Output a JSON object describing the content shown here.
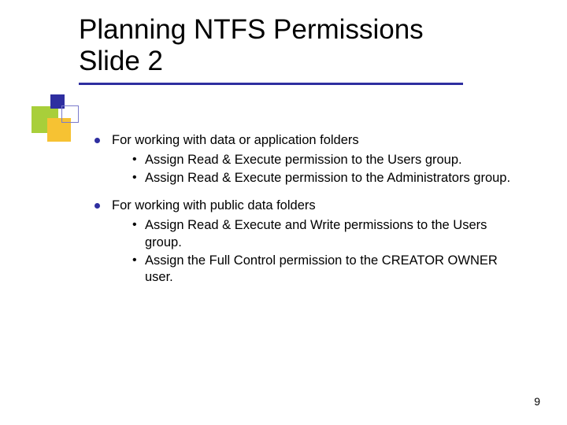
{
  "title": {
    "line1": "Planning NTFS Permissions",
    "line2": "Slide 2"
  },
  "bullets": [
    {
      "text": "For working with data or application folders",
      "sub": [
        "Assign Read & Execute permission to the Users group.",
        "Assign Read & Execute permission to the Administrators group."
      ]
    },
    {
      "text": "For working with public data folders",
      "sub": [
        "Assign Read & Execute and Write permissions to the Users group.",
        "Assign the Full Control permission to the CREATOR OWNER user."
      ]
    }
  ],
  "page_number": "9"
}
